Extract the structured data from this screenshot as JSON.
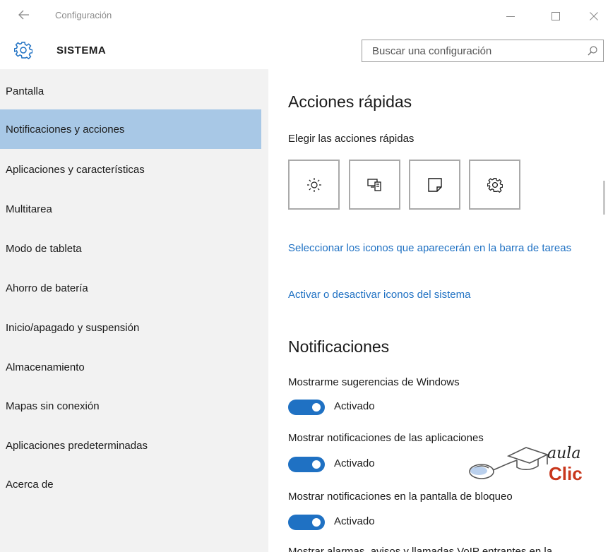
{
  "window": {
    "title": "Configuración",
    "back_icon": "back-arrow-icon",
    "minimize_icon": "minimize-icon",
    "maximize_icon": "maximize-icon",
    "close_icon": "close-icon"
  },
  "header": {
    "icon": "gear-icon",
    "title": "SISTEMA",
    "search_placeholder": "Buscar una configuración",
    "search_icon": "search-icon"
  },
  "sidebar": {
    "selected_index": 1,
    "items": [
      {
        "label": "Pantalla"
      },
      {
        "label": "Notificaciones y acciones"
      },
      {
        "label": "Aplicaciones y características"
      },
      {
        "label": "Multitarea"
      },
      {
        "label": "Modo de tableta"
      },
      {
        "label": "Ahorro de batería"
      },
      {
        "label": "Inicio/apagado y suspensión"
      },
      {
        "label": "Almacenamiento"
      },
      {
        "label": "Mapas sin conexión"
      },
      {
        "label": "Aplicaciones predeterminadas"
      },
      {
        "label": "Acerca de"
      }
    ]
  },
  "main": {
    "quick_actions": {
      "heading": "Acciones rápidas",
      "subheading": "Elegir las acciones rápidas",
      "tiles": [
        {
          "icon": "brightness-icon"
        },
        {
          "icon": "project-display-icon"
        },
        {
          "icon": "note-icon"
        },
        {
          "icon": "gear-icon"
        }
      ],
      "link_taskbar_icons": "Seleccionar los iconos que aparecerán en la barra de tareas",
      "link_system_icons": "Activar o desactivar iconos del sistema"
    },
    "notifications": {
      "heading": "Notificaciones",
      "settings": [
        {
          "label": "Mostrarme sugerencias de Windows",
          "state": "Activado",
          "on": true
        },
        {
          "label": "Mostrar notificaciones de las aplicaciones",
          "state": "Activado",
          "on": true
        },
        {
          "label": "Mostrar notificaciones en la pantalla de bloqueo",
          "state": "Activado",
          "on": true
        }
      ],
      "partial_next_label": "Mostrar alarmas, avisos y llamadas VoIP entrantes en la"
    }
  },
  "watermark": {
    "line1": "aula",
    "line2": "Clic"
  },
  "colors": {
    "accent": "#1f71c3",
    "selected_bg": "#a8c8e6",
    "sidebar_bg": "#f2f2f2",
    "watermark_red": "#c8361b"
  }
}
